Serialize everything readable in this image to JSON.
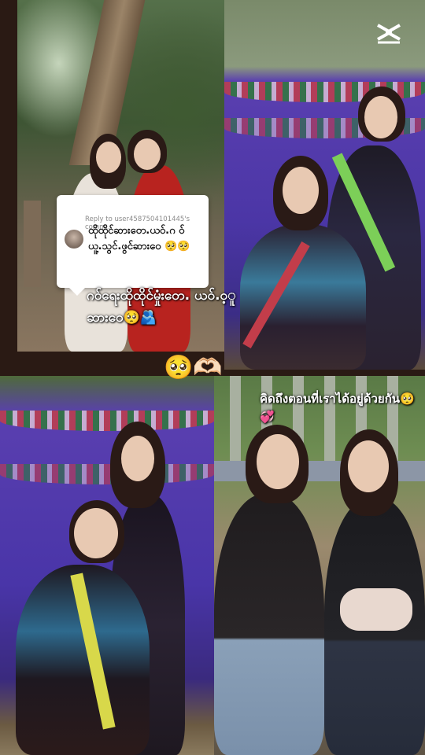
{
  "reply_bubble": {
    "header": "Reply to user4587504101445's comm...",
    "comment": "ထိုထိုင်ဆား‌တေ.ယဝ်.ဂ ဝ်ယူ့.သွင်.ဖွင်ဆားဝေ 🥺🥺"
  },
  "caption_1": "ဂဝ်ရေးထိုထိုင်မှုံး‌တေ. ယဝ်.ဝ့ူဆားဝေ🥺🫂",
  "caption_2": "คิดถึงตอนที่เราได้อยู่ด้วยกัน🥺💞",
  "center_emoji": "🥺🫶🏻",
  "logo": {
    "icon": "capcut-logo-icon"
  }
}
